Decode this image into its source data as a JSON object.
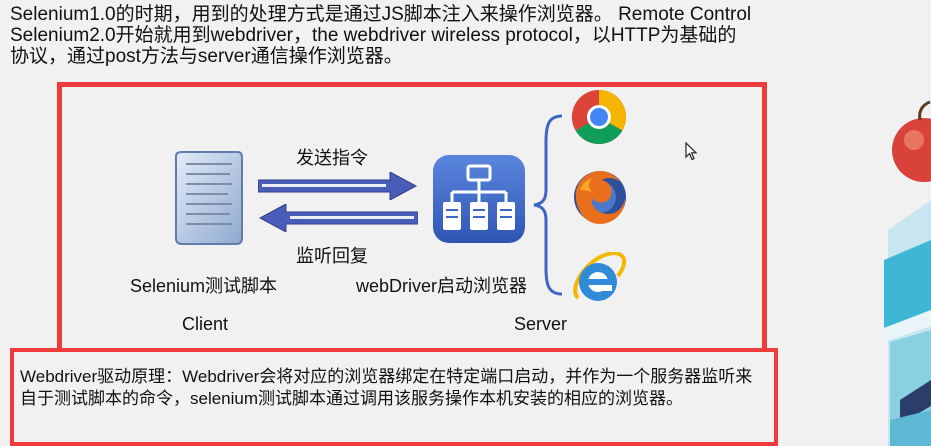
{
  "intro": {
    "line1": "Selenium1.0的时期，用到的处理方式是通过JS脚本注入来操作浏览器。 Remote Control",
    "line2": "Selenium2.0开始就用到webdriver，the webdriver wireless protocol，以HTTP为基础的",
    "line3": "协议，通过post方法与server通信操作浏览器。"
  },
  "diagram": {
    "send_label": "发送指令",
    "reply_label": "监听回复",
    "script_label": "Selenium测试脚本",
    "driver_label": "webDriver启动浏览器",
    "client_label": "Client",
    "server_label": "Server"
  },
  "icons": {
    "script": "script-scroll-icon",
    "server": "server-network-icon",
    "chrome": "chrome-icon",
    "firefox": "firefox-icon",
    "ie": "internet-explorer-icon",
    "cursor": "mouse-cursor-icon"
  },
  "note": {
    "text": "Webdriver驱动原理：Webdriver会将对应的浏览器绑定在特定端口启动，并作为一个服务器监听来自于测试脚本的命令，selenium测试脚本通过调用该服务操作本机安装的相应的浏览器。"
  },
  "colors": {
    "frame_border": "#ef3b3b",
    "arrow_fill": "#4a5db8",
    "server_icon_bg": "#3d66c9"
  }
}
